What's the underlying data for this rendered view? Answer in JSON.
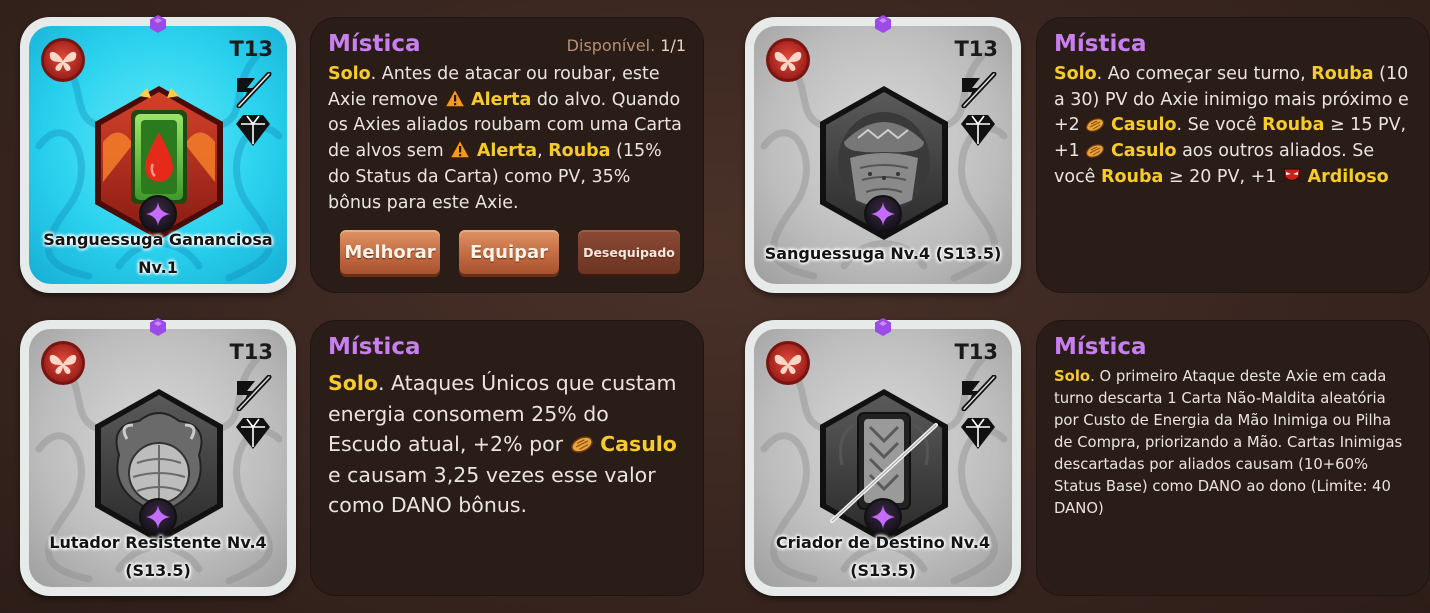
{
  "colors": {
    "background": "#3a2620",
    "panel": "#2a1c17",
    "rarity": "#c880f0",
    "keyword": "#f6cb2a",
    "text": "#eae4de",
    "button": "#c36b42"
  },
  "cards": [
    {
      "tier": "T13",
      "name_line1": "Sanguessuga Gananciosa",
      "name_line2": "Nv.1",
      "badge_icon": "butterfly-badge-icon",
      "energy_icon": "no-energy-icon",
      "type_icon": "diamond-gem-icon",
      "art_icon": "blood-drop-card-art",
      "rarity": "Mística",
      "availability_label": "Disponível.",
      "availability_value": "1/1",
      "desc": {
        "solo": "Solo",
        "t1": ". Antes de atacar ou roubar, este Axie remove ",
        "k1": "Alerta",
        "t2": " do alvo. Quando os Axies aliados roubam com uma Carta de alvos sem ",
        "k2": "Alerta",
        "t3": ", ",
        "k3": "Rouba",
        "t4": " (15% do Status da Carta) como PV, 35% bônus para este Axie."
      },
      "buttons": {
        "upgrade": "Melhorar",
        "equip": "Equipar",
        "unequip": "Desequipado"
      }
    },
    {
      "tier": "T13",
      "name_line1": "Sanguessuga Nv.4 (S13.5)",
      "rarity": "Mística",
      "desc": {
        "solo": "Solo",
        "t1": ". Ao começar seu turno, ",
        "k1": "Rouba",
        "t2": " (10 a 30) PV do Axie inimigo mais próximo e +2 ",
        "k2": "Casulo",
        "t3": ". Se você ",
        "k3": "Rouba",
        "t4": " ≥ 15 PV, +1 ",
        "k4": "Casulo",
        "t5": " aos outros aliados. Se você ",
        "k5": "Rouba",
        "t6": " ≥ 20 PV, +1 ",
        "k6": "Ardiloso"
      }
    },
    {
      "tier": "T13",
      "name_line1": "Lutador Resistente Nv.4",
      "name_line2": "(S13.5)",
      "rarity": "Mística",
      "desc": {
        "solo": "Solo",
        "t1": ". Ataques Únicos que custam energia consomem 25% do Escudo atual, +2% por ",
        "k1": "Casulo",
        "t2": " e causam 3,25 vezes esse valor como DANO bônus."
      }
    },
    {
      "tier": "T13",
      "name_line1": "Criador de Destino Nv.4",
      "name_line2": "(S13.5)",
      "rarity": "Mística",
      "desc": {
        "solo": "Solo",
        "t1": ". O primeiro Ataque deste Axie em cada turno descarta 1 Carta Não-Maldita aleatória por Custo de Energia da Mão Inimiga ou Pilha de Compra, priorizando a Mão. Cartas Inimigas descartadas por aliados causam (10+60% Status Base) como DANO ao dono (Limite: 40 DANO)"
      }
    }
  ]
}
